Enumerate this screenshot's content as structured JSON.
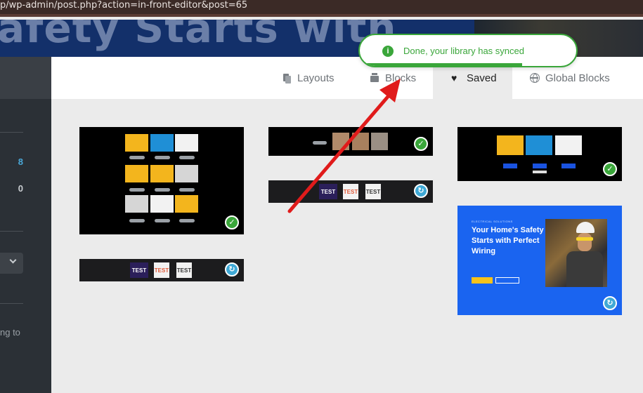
{
  "browser": {
    "url": "p/wp-admin/post.php?action=in-front-editor&post=65"
  },
  "hero": {
    "text": "afety Starts with"
  },
  "sidebar": {
    "count_primary": "8",
    "count_secondary": "0",
    "text_fragment": "ng to"
  },
  "tabs": [
    {
      "label": "Layouts",
      "icon": "layouts-icon",
      "active": false
    },
    {
      "label": "Blocks",
      "icon": "blocks-icon",
      "active": false
    },
    {
      "label": "Saved",
      "icon": "heart-icon",
      "active": true
    },
    {
      "label": "Global Blocks",
      "icon": "globe-icon",
      "active": false
    }
  ],
  "toast": {
    "message": "Done, your library has synced",
    "progress": 0.75,
    "color": "#3aa63a"
  },
  "cards": {
    "test_label": "TEST",
    "blue_card": {
      "eyebrow": "ELECTRICAL SOLUTIONS",
      "headline": "Your Home's Safety Starts with Perfect Wiring"
    }
  },
  "colors": {
    "accent_blue": "#1a64f0",
    "success_green": "#3aa63a",
    "sync_blue": "#3fa9d6",
    "annotation_red": "#e01b1b"
  }
}
